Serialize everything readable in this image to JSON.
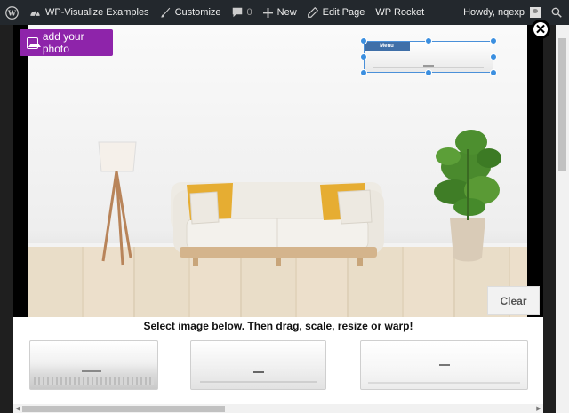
{
  "admin_bar": {
    "site_name": "WP-Visualize Examples",
    "customize": "Customize",
    "comments_count": "0",
    "new": "New",
    "edit_page": "Edit Page",
    "wp_rocket": "WP Rocket",
    "greeting": "Howdy, nqexp"
  },
  "editor": {
    "add_photo_label": "add your photo",
    "placed_item_label": "Menu",
    "clear_label": "Clear",
    "close_symbol": "✕"
  },
  "panel": {
    "title": "Select image below. Then drag, scale, resize or warp!",
    "items": [
      "air-conditioner-1",
      "air-conditioner-2",
      "air-conditioner-3"
    ]
  },
  "colors": {
    "admin_bar": "#23282d",
    "accent_purple": "#8e24aa",
    "handle_blue": "#3b8fe0"
  }
}
